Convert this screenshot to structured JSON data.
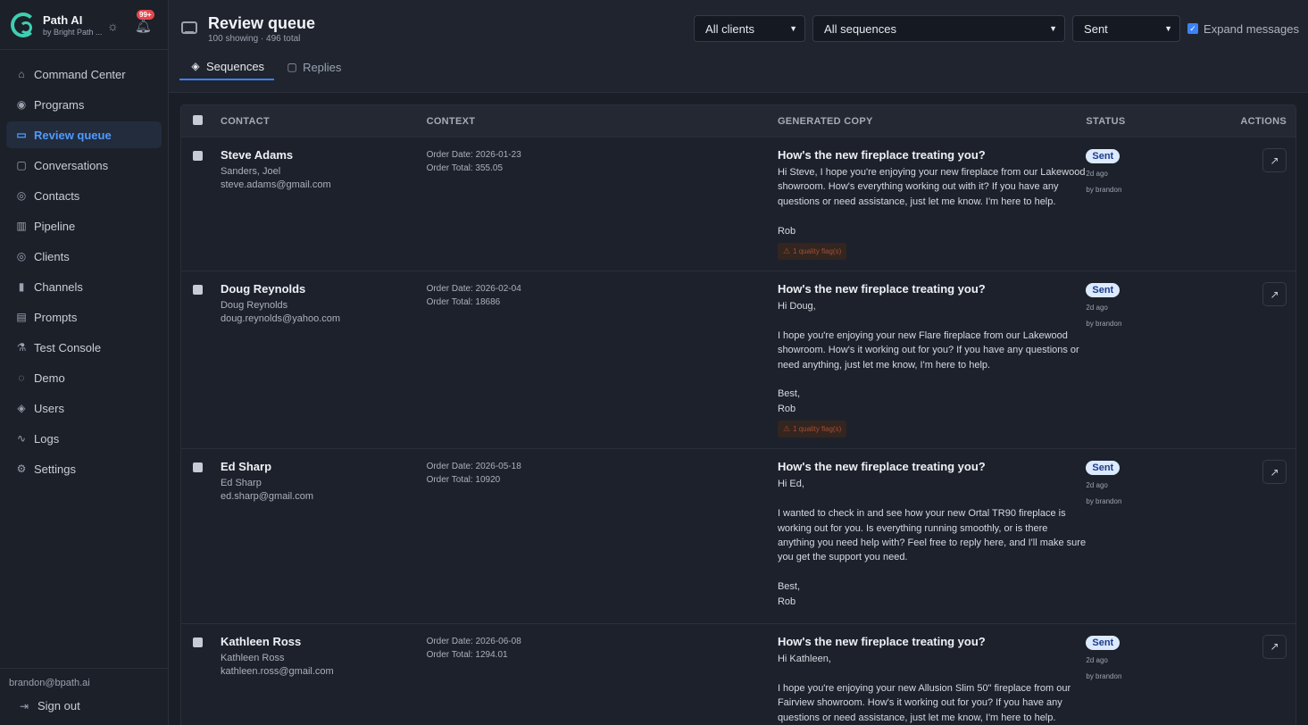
{
  "app": {
    "name": "Path AI",
    "sub": "by Bright Path ...",
    "notifications": "99+"
  },
  "nav": [
    {
      "label": "Command Center",
      "icon": "home-icon",
      "glyph": "⌂"
    },
    {
      "label": "Programs",
      "icon": "radio-icon",
      "glyph": "◉"
    },
    {
      "label": "Review queue",
      "icon": "inbox-icon",
      "glyph": "▭",
      "active": true
    },
    {
      "label": "Conversations",
      "icon": "chat-icon",
      "glyph": "▢"
    },
    {
      "label": "Contacts",
      "icon": "user-icon",
      "glyph": "◎"
    },
    {
      "label": "Pipeline",
      "icon": "columns-icon",
      "glyph": "▥"
    },
    {
      "label": "Clients",
      "icon": "users-icon",
      "glyph": "◎"
    },
    {
      "label": "Channels",
      "icon": "signal-icon",
      "glyph": "▮"
    },
    {
      "label": "Prompts",
      "icon": "file-icon",
      "glyph": "▤"
    },
    {
      "label": "Test Console",
      "icon": "flask-icon",
      "glyph": "⚗"
    },
    {
      "label": "Demo",
      "icon": "compass-icon",
      "glyph": "◌"
    },
    {
      "label": "Users",
      "icon": "shield-icon",
      "glyph": "◈"
    },
    {
      "label": "Logs",
      "icon": "activity-icon",
      "glyph": "∿"
    },
    {
      "label": "Settings",
      "icon": "gear-icon",
      "glyph": "⚙"
    }
  ],
  "footer": {
    "email": "brandon@bpath.ai",
    "signout": "Sign out"
  },
  "header": {
    "title": "Review queue",
    "subtitle": "100 showing · 496 total",
    "filters": {
      "clients": "All clients",
      "sequences": "All sequences",
      "status": "Sent",
      "expand": "Expand messages",
      "expand_checked": true
    },
    "tabs": [
      {
        "label": "Sequences",
        "active": true
      },
      {
        "label": "Replies",
        "active": false
      }
    ]
  },
  "table": {
    "columns": {
      "contact": "CONTACT",
      "context": "CONTEXT",
      "copy": "GENERATED COPY",
      "status": "STATUS",
      "actions": "ACTIONS"
    },
    "rows": [
      {
        "name": "Steve Adams",
        "company": "Sanders, Joel",
        "email": "steve.adams@gmail.com",
        "order_date": "Order Date: 2026-01-23",
        "order_total": "Order Total: 355.05",
        "subject": "How's the new fireplace treating you?",
        "body": "Hi Steve, I hope you're enjoying your new fireplace from our Lakewood showroom. How's everything working out with it? If you have any questions or need assistance, just let me know. I'm here to help.\n\nRob",
        "flag": "1 quality flag(s)",
        "status": "Sent",
        "time": "2d ago",
        "by": "by brandon"
      },
      {
        "name": "Doug Reynolds",
        "company": "Doug Reynolds",
        "email": "doug.reynolds@yahoo.com",
        "order_date": "Order Date: 2026-02-04",
        "order_total": "Order Total: 18686",
        "subject": "How's the new fireplace treating you?",
        "body": "Hi Doug,\n\nI hope you're enjoying your new Flare fireplace from our Lakewood showroom. How's it working out for you? If you have any questions or need anything, just let me know, I'm here to help.\n\nBest,\nRob",
        "flag": "1 quality flag(s)",
        "status": "Sent",
        "time": "2d ago",
        "by": "by brandon"
      },
      {
        "name": "Ed Sharp",
        "company": "Ed Sharp",
        "email": "ed.sharp@gmail.com",
        "order_date": "Order Date: 2026-05-18",
        "order_total": "Order Total: 10920",
        "subject": "How's the new fireplace treating you?",
        "body": "Hi Ed,\n\nI wanted to check in and see how your new Ortal TR90 fireplace is working out for you. Is everything running smoothly, or is there anything you need help with? Feel free to reply here, and I'll make sure you get the support you need.\n\nBest,\nRob",
        "flag": "",
        "status": "Sent",
        "time": "2d ago",
        "by": "by brandon"
      },
      {
        "name": "Kathleen Ross",
        "company": "Kathleen Ross",
        "email": "kathleen.ross@gmail.com",
        "order_date": "Order Date: 2026-06-08",
        "order_total": "Order Total: 1294.01",
        "subject": "How's the new fireplace treating you?",
        "body": "Hi Kathleen,\n\nI hope you're enjoying your new Allusion Slim 50\" fireplace from our Fairview showroom. How's it working out for you? If you have any questions or need assistance, just let me know, I'm here to help.",
        "flag": "",
        "status": "Sent",
        "time": "2d ago",
        "by": "by brandon"
      }
    ]
  }
}
